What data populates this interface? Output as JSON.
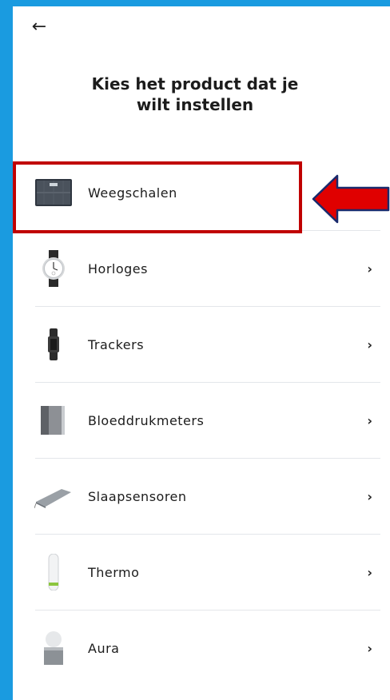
{
  "header": {
    "back_icon": "arrow-left-icon"
  },
  "title": "Kies het product   dat je\nwilt instellen",
  "products": [
    {
      "label": "Weegschalen",
      "icon": "scale-icon",
      "chevron": ""
    },
    {
      "label": "Horloges",
      "icon": "watch-icon",
      "chevron": "›"
    },
    {
      "label": "Trackers",
      "icon": "tracker-icon",
      "chevron": "›"
    },
    {
      "label": "Bloeddrukmeters",
      "icon": "blood-pressure-monitor-icon",
      "chevron": "›"
    },
    {
      "label": "Slaapsensoren",
      "icon": "sleep-sensor-icon",
      "chevron": "›"
    },
    {
      "label": "Thermo",
      "icon": "thermometer-icon",
      "chevron": "›"
    },
    {
      "label": "Aura",
      "icon": "aura-icon",
      "chevron": "›"
    }
  ],
  "annotation": {
    "highlight_color": "#c00000",
    "arrow_color": "#e00000",
    "arrow_outline": "#1a2a6c"
  },
  "colors": {
    "frame": "#1a9be0",
    "background": "#ffffff",
    "divider": "#e3e6ea"
  }
}
